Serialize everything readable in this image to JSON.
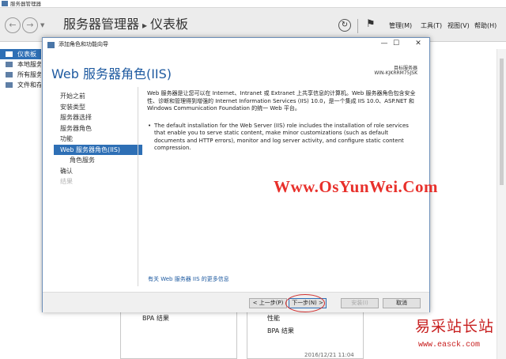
{
  "server_manager": {
    "window_title": "服务器管理器",
    "breadcrumb": {
      "app": "服务器管理器",
      "page": "仪表板"
    },
    "menu": {
      "manage": "管理(M)",
      "tools": "工具(T)",
      "view": "视图(V)",
      "help": "帮助(H)"
    },
    "sidebar": {
      "items": [
        {
          "label": "仪表板",
          "icon": "dashboard-icon",
          "active": true
        },
        {
          "label": "本地服务器",
          "icon": "server-icon",
          "active": false
        },
        {
          "label": "所有服务器",
          "icon": "servers-icon",
          "active": false
        },
        {
          "label": "文件和存储服务",
          "icon": "storage-icon",
          "active": false
        }
      ]
    },
    "tiles": {
      "left_bpa": "BPA 结果",
      "right_performance": "性能",
      "right_bpa": "BPA 结果",
      "timestamp": "2016/12/21 11:04"
    }
  },
  "wizard": {
    "window_title": "添加角色和功能向导",
    "heading": "Web 服务器角色(IIS)",
    "target_label": "目标服务器",
    "target_value": "WIN-KJKRRM75JSK",
    "steps": [
      {
        "label": "开始之前",
        "state": "normal"
      },
      {
        "label": "安装类型",
        "state": "normal"
      },
      {
        "label": "服务器选择",
        "state": "normal"
      },
      {
        "label": "服务器角色",
        "state": "normal"
      },
      {
        "label": "功能",
        "state": "normal"
      },
      {
        "label": "Web 服务器角色(IIS)",
        "state": "active"
      },
      {
        "label": "角色服务",
        "state": "sub"
      },
      {
        "label": "确认",
        "state": "normal"
      },
      {
        "label": "结果",
        "state": "disabled"
      }
    ],
    "description": "Web 服务器是让您可以在 Internet、Intranet 或 Extranet 上共享信息的计算机。Web 服务器角色包含安全性、诊断和管理得到增强的 Internet Information Services (IIS) 10.0，是一个集成 IIS 10.0、ASP.NET 和 Windows Communication Foundation 的统一 Web 平台。",
    "bullet": "The default installation for the Web Server (IIS) role includes the installation of role services that enable you to serve static content, make minor customizations (such as default documents and HTTP errors), monitor and log server activity, and configure static content compression.",
    "more_info_link": "有关 Web 服务器 IIS 的更多信息",
    "buttons": {
      "prev": "< 上一步(P)",
      "next": "下一步(N) >",
      "install": "安装(I)",
      "cancel": "取消"
    }
  },
  "watermarks": {
    "site_url": "Www.OsYunWei.Com",
    "site_cn": "易采站长站",
    "site_cn_url": "www.easck.com"
  },
  "colors": {
    "accent": "#2e6fb5",
    "heading": "#1e5aa0",
    "watermark": "#e8302b"
  }
}
